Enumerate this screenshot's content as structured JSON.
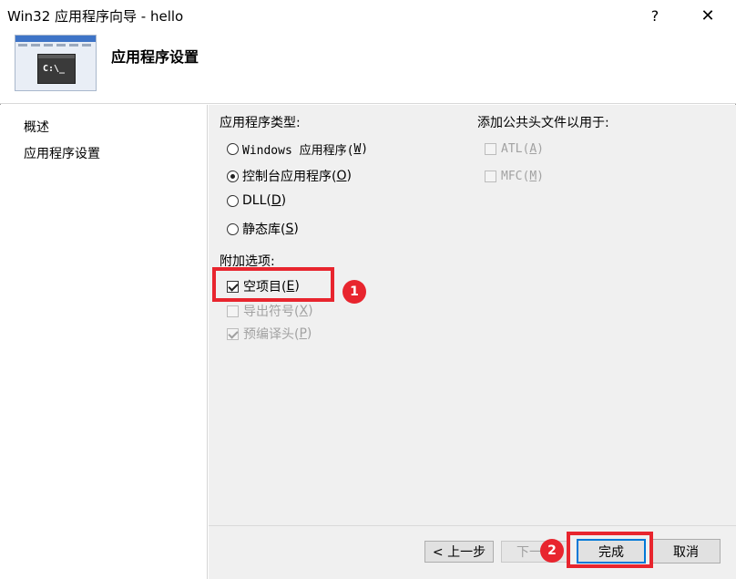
{
  "window": {
    "title": "Win32 应用程序向导 - hello",
    "help_label": "?",
    "close_label": "✕"
  },
  "header": {
    "heading": "应用程序设置",
    "thumb_text": "C:\\_"
  },
  "sidebar": {
    "items": [
      {
        "label": "概述"
      },
      {
        "label": "应用程序设置"
      }
    ]
  },
  "app_type": {
    "label": "应用程序类型:",
    "options": [
      {
        "text": "Windows 应用程序(",
        "key": "W",
        "close": ")",
        "selected": false
      },
      {
        "text": "控制台应用程序(",
        "key": "O",
        "close": ")",
        "selected": true
      },
      {
        "text": "DLL(",
        "key": "D",
        "close": ")",
        "selected": false
      },
      {
        "text": "静态库(",
        "key": "S",
        "close": ")",
        "selected": false
      }
    ]
  },
  "extra_options": {
    "label": "附加选项:",
    "items": [
      {
        "text": "空项目(",
        "key": "E",
        "close": ")",
        "checked": true,
        "enabled": true
      },
      {
        "text": "导出符号(",
        "key": "X",
        "close": ")",
        "checked": false,
        "enabled": false
      },
      {
        "text": "预编译头(",
        "key": "P",
        "close": ")",
        "checked": true,
        "enabled": false
      }
    ]
  },
  "common_headers": {
    "label": "添加公共头文件以用于:",
    "items": [
      {
        "text": "ATL(",
        "key": "A",
        "close": ")",
        "checked": false,
        "enabled": false
      },
      {
        "text": "MFC(",
        "key": "M",
        "close": ")",
        "checked": false,
        "enabled": false
      }
    ]
  },
  "buttons": {
    "prev": "< 上一步",
    "next": "下一步",
    "finish": "完成",
    "cancel": "取消"
  },
  "annotations": {
    "badge1": "1",
    "badge2": "2",
    "color": "#e8252e"
  }
}
